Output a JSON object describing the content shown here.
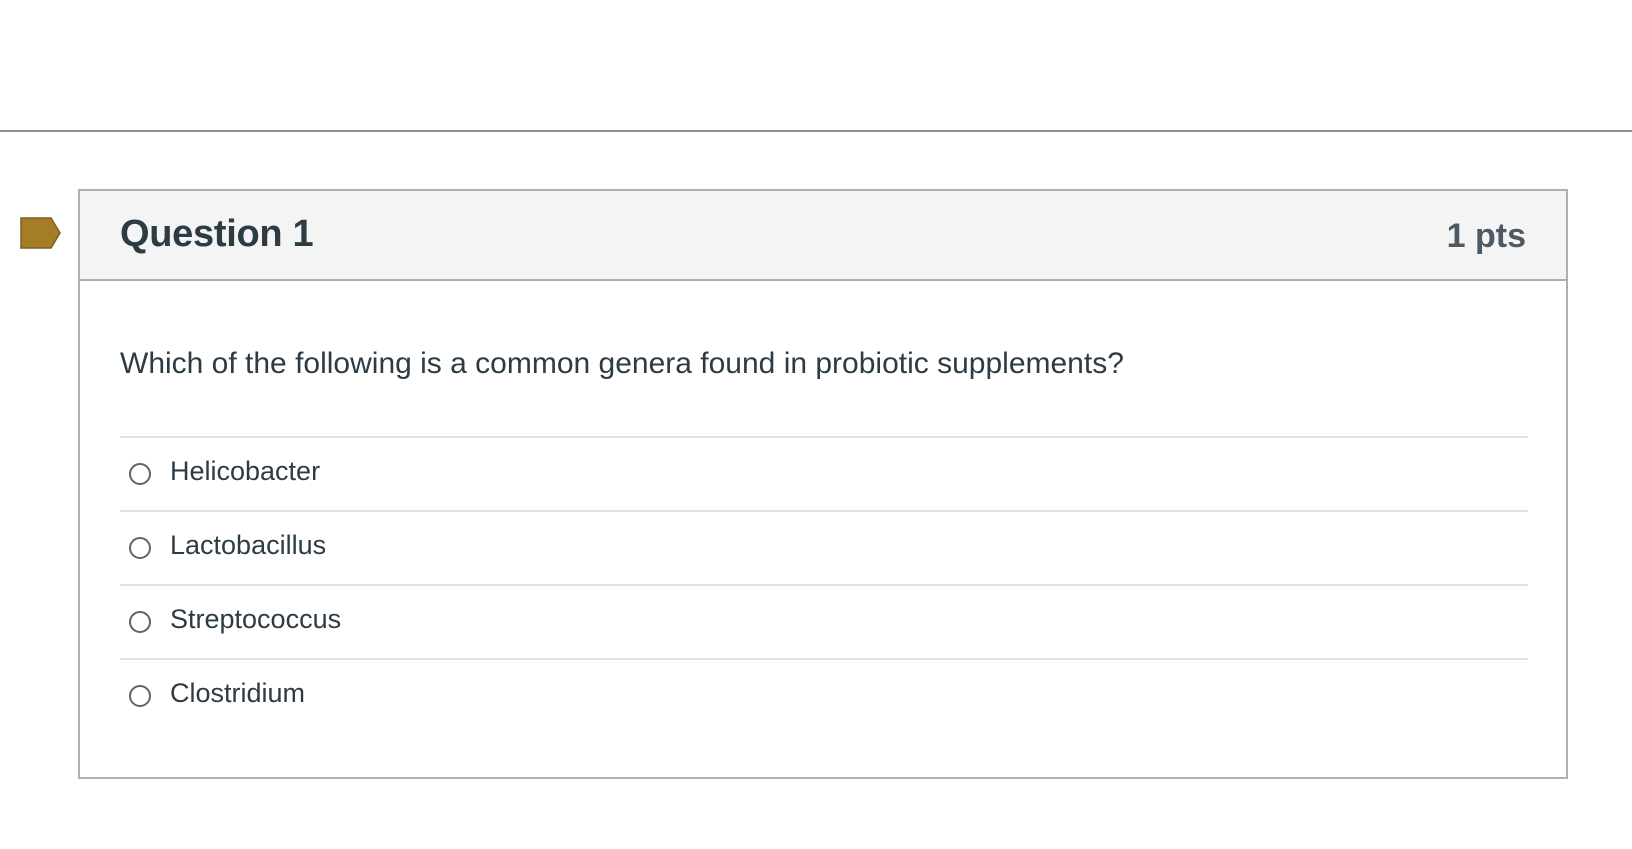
{
  "question": {
    "title": "Question 1",
    "points": "1 pts",
    "text": "Which of the following is a common genera found in probiotic supplements?",
    "flag_icon": "flag-marker-icon",
    "flag_color": "#a57c28"
  },
  "answers": [
    {
      "label": "Helicobacter",
      "selected": false
    },
    {
      "label": "Lactobacillus",
      "selected": false
    },
    {
      "label": "Streptococcus",
      "selected": false
    },
    {
      "label": "Clostridium",
      "selected": false
    }
  ]
}
